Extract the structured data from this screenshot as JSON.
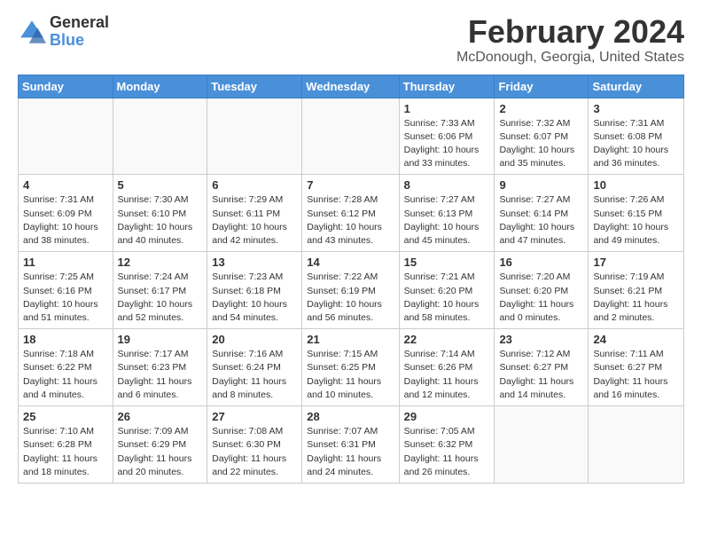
{
  "header": {
    "logo_general": "General",
    "logo_blue": "Blue",
    "title": "February 2024",
    "subtitle": "McDonough, Georgia, United States"
  },
  "days_of_week": [
    "Sunday",
    "Monday",
    "Tuesday",
    "Wednesday",
    "Thursday",
    "Friday",
    "Saturday"
  ],
  "weeks": [
    [
      {
        "day": "",
        "info": ""
      },
      {
        "day": "",
        "info": ""
      },
      {
        "day": "",
        "info": ""
      },
      {
        "day": "",
        "info": ""
      },
      {
        "day": "1",
        "info": "Sunrise: 7:33 AM\nSunset: 6:06 PM\nDaylight: 10 hours\nand 33 minutes."
      },
      {
        "day": "2",
        "info": "Sunrise: 7:32 AM\nSunset: 6:07 PM\nDaylight: 10 hours\nand 35 minutes."
      },
      {
        "day": "3",
        "info": "Sunrise: 7:31 AM\nSunset: 6:08 PM\nDaylight: 10 hours\nand 36 minutes."
      }
    ],
    [
      {
        "day": "4",
        "info": "Sunrise: 7:31 AM\nSunset: 6:09 PM\nDaylight: 10 hours\nand 38 minutes."
      },
      {
        "day": "5",
        "info": "Sunrise: 7:30 AM\nSunset: 6:10 PM\nDaylight: 10 hours\nand 40 minutes."
      },
      {
        "day": "6",
        "info": "Sunrise: 7:29 AM\nSunset: 6:11 PM\nDaylight: 10 hours\nand 42 minutes."
      },
      {
        "day": "7",
        "info": "Sunrise: 7:28 AM\nSunset: 6:12 PM\nDaylight: 10 hours\nand 43 minutes."
      },
      {
        "day": "8",
        "info": "Sunrise: 7:27 AM\nSunset: 6:13 PM\nDaylight: 10 hours\nand 45 minutes."
      },
      {
        "day": "9",
        "info": "Sunrise: 7:27 AM\nSunset: 6:14 PM\nDaylight: 10 hours\nand 47 minutes."
      },
      {
        "day": "10",
        "info": "Sunrise: 7:26 AM\nSunset: 6:15 PM\nDaylight: 10 hours\nand 49 minutes."
      }
    ],
    [
      {
        "day": "11",
        "info": "Sunrise: 7:25 AM\nSunset: 6:16 PM\nDaylight: 10 hours\nand 51 minutes."
      },
      {
        "day": "12",
        "info": "Sunrise: 7:24 AM\nSunset: 6:17 PM\nDaylight: 10 hours\nand 52 minutes."
      },
      {
        "day": "13",
        "info": "Sunrise: 7:23 AM\nSunset: 6:18 PM\nDaylight: 10 hours\nand 54 minutes."
      },
      {
        "day": "14",
        "info": "Sunrise: 7:22 AM\nSunset: 6:19 PM\nDaylight: 10 hours\nand 56 minutes."
      },
      {
        "day": "15",
        "info": "Sunrise: 7:21 AM\nSunset: 6:20 PM\nDaylight: 10 hours\nand 58 minutes."
      },
      {
        "day": "16",
        "info": "Sunrise: 7:20 AM\nSunset: 6:20 PM\nDaylight: 11 hours\nand 0 minutes."
      },
      {
        "day": "17",
        "info": "Sunrise: 7:19 AM\nSunset: 6:21 PM\nDaylight: 11 hours\nand 2 minutes."
      }
    ],
    [
      {
        "day": "18",
        "info": "Sunrise: 7:18 AM\nSunset: 6:22 PM\nDaylight: 11 hours\nand 4 minutes."
      },
      {
        "day": "19",
        "info": "Sunrise: 7:17 AM\nSunset: 6:23 PM\nDaylight: 11 hours\nand 6 minutes."
      },
      {
        "day": "20",
        "info": "Sunrise: 7:16 AM\nSunset: 6:24 PM\nDaylight: 11 hours\nand 8 minutes."
      },
      {
        "day": "21",
        "info": "Sunrise: 7:15 AM\nSunset: 6:25 PM\nDaylight: 11 hours\nand 10 minutes."
      },
      {
        "day": "22",
        "info": "Sunrise: 7:14 AM\nSunset: 6:26 PM\nDaylight: 11 hours\nand 12 minutes."
      },
      {
        "day": "23",
        "info": "Sunrise: 7:12 AM\nSunset: 6:27 PM\nDaylight: 11 hours\nand 14 minutes."
      },
      {
        "day": "24",
        "info": "Sunrise: 7:11 AM\nSunset: 6:27 PM\nDaylight: 11 hours\nand 16 minutes."
      }
    ],
    [
      {
        "day": "25",
        "info": "Sunrise: 7:10 AM\nSunset: 6:28 PM\nDaylight: 11 hours\nand 18 minutes."
      },
      {
        "day": "26",
        "info": "Sunrise: 7:09 AM\nSunset: 6:29 PM\nDaylight: 11 hours\nand 20 minutes."
      },
      {
        "day": "27",
        "info": "Sunrise: 7:08 AM\nSunset: 6:30 PM\nDaylight: 11 hours\nand 22 minutes."
      },
      {
        "day": "28",
        "info": "Sunrise: 7:07 AM\nSunset: 6:31 PM\nDaylight: 11 hours\nand 24 minutes."
      },
      {
        "day": "29",
        "info": "Sunrise: 7:05 AM\nSunset: 6:32 PM\nDaylight: 11 hours\nand 26 minutes."
      },
      {
        "day": "",
        "info": ""
      },
      {
        "day": "",
        "info": ""
      }
    ]
  ]
}
